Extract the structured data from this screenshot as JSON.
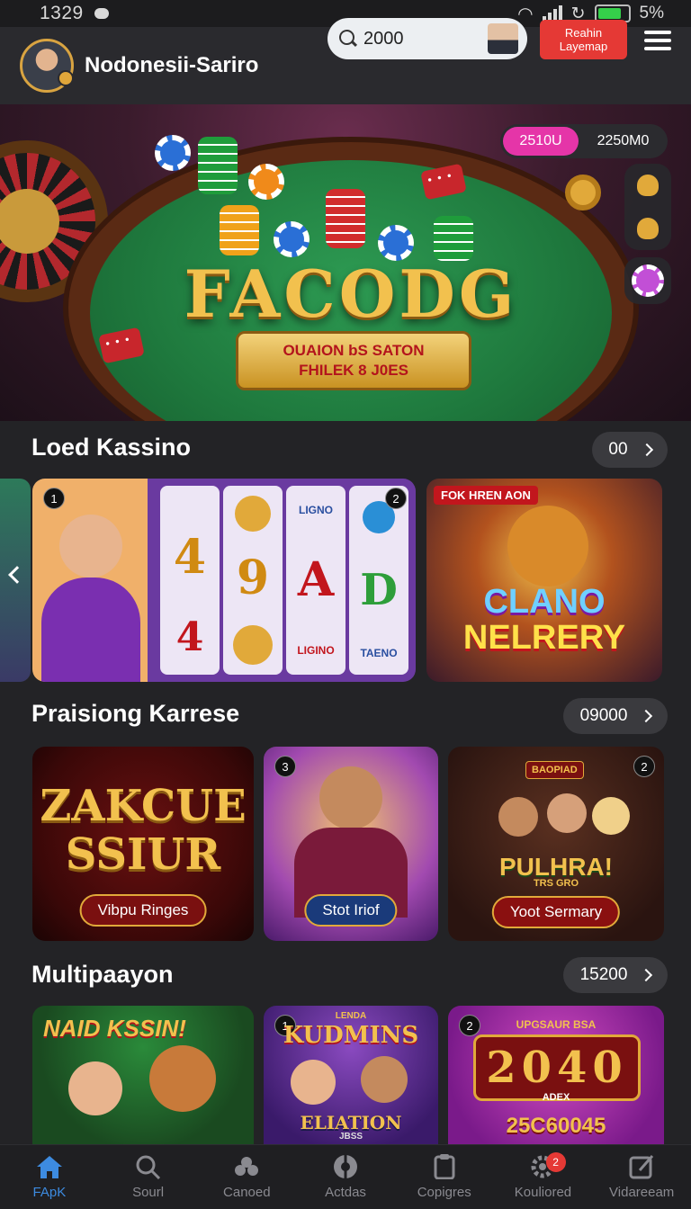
{
  "status_bar": {
    "time": "1329",
    "battery": "5%"
  },
  "header": {
    "username": "Nodonesii-Sariro",
    "search_value": "2000",
    "cta_line1": "Reahin",
    "cta_line2": "Layemap"
  },
  "hero": {
    "title": "FACODG",
    "ribbon_line1": "OUAION bS SATON",
    "ribbon_line2": "FHILEK 8 J0ES",
    "pill_pink": "2510U",
    "pill_dark": "2250M0"
  },
  "sections": [
    {
      "title": "Loed Kassino",
      "more": "00",
      "cards": [
        {
          "num": "1",
          "reels": [
            "4",
            "9",
            "A",
            "D",
            "4",
            "",
            "",
            ""
          ],
          "reel_labels": [
            "",
            "",
            "LIGNO",
            "TAENO",
            "",
            "",
            "LIGINO",
            ""
          ],
          "num_right": "2"
        },
        {
          "tag": "FOK HREN AON",
          "line1": "CLANO",
          "line2": "NELRERY"
        }
      ]
    },
    {
      "title": "Praisiong Karrese",
      "more": "09000",
      "cards": [
        {
          "line1": "ZAKCUE",
          "line2": "SSIUR",
          "banner": "Vibpu Ringes"
        },
        {
          "num": "3",
          "banner": "Stot Iriof"
        },
        {
          "num": "2",
          "badge": "BAOPIAD",
          "line1": "PULHRA!",
          "sub": "TRS GRO",
          "banner": "Yoot Sermary"
        }
      ]
    },
    {
      "title": "Multipaayon",
      "more": "15200",
      "cards": [
        {
          "line1": "NAID KSSIN!"
        },
        {
          "num": "1",
          "top": "LENDA",
          "line1": "KUDMINS",
          "line2": "ELIATION",
          "sub": "JBSS"
        },
        {
          "num": "2",
          "top": "UPGSAUR BSA",
          "digits": "2040",
          "sub": "ADEX",
          "line1": "25C60045"
        }
      ]
    }
  ],
  "bottom_nav": [
    {
      "label": "FApK",
      "icon": "home-icon"
    },
    {
      "label": "Sourl",
      "icon": "search-icon"
    },
    {
      "label": "Canoed",
      "icon": "cards-icon"
    },
    {
      "label": "Actdas",
      "icon": "casino-chip-icon"
    },
    {
      "label": "Copigres",
      "icon": "clipboard-icon"
    },
    {
      "label": "Kouliored",
      "icon": "settings-icon",
      "badge": "2"
    },
    {
      "label": "Vidareeam",
      "icon": "edit-icon"
    }
  ],
  "colors": {
    "accent": "#3d8be0",
    "cta": "#e53935",
    "pink": "#e535a8",
    "gold": "#f2c14e"
  }
}
